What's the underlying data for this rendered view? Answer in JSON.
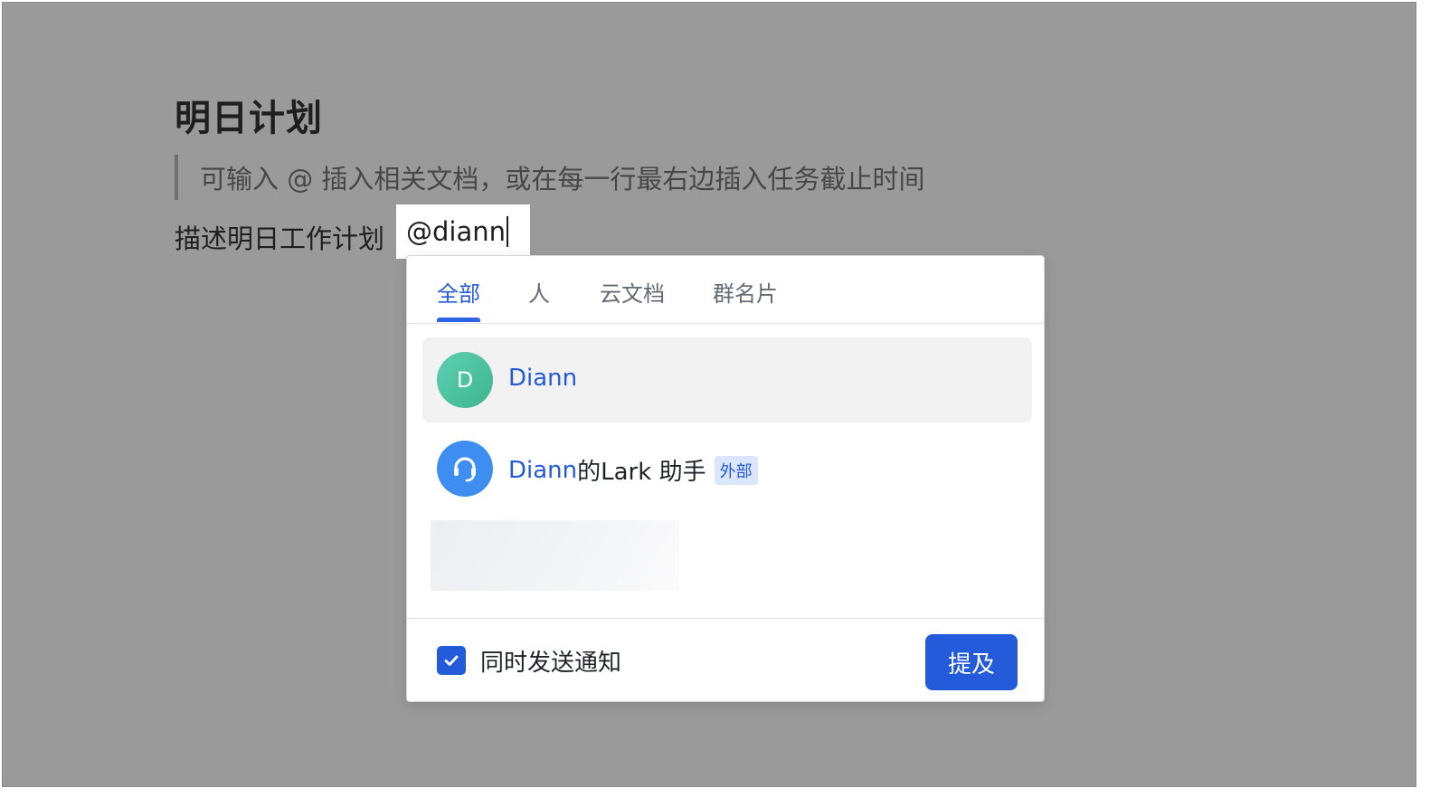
{
  "document": {
    "title": "明日计划",
    "quote_hint": "可输入 @ 插入相关文档，或在每一行最右边插入任务截止时间",
    "body_text": "描述明日工作计划",
    "mention_query": "@diann"
  },
  "mention_popup": {
    "tabs": [
      {
        "label": "全部",
        "active": true
      },
      {
        "label": "人",
        "active": false
      },
      {
        "label": "云文档",
        "active": false
      },
      {
        "label": "群名片",
        "active": false
      }
    ],
    "results": [
      {
        "avatar_text": "D",
        "name_highlight": "Diann",
        "name_rest": "",
        "selected": true
      },
      {
        "avatar_icon": "headset-icon",
        "name_highlight": "Diann",
        "name_rest": "的Lark 助手",
        "badge": "外部",
        "selected": false
      }
    ],
    "footer": {
      "notify_label": "同时发送通知",
      "notify_checked": true,
      "confirm_label": "提及"
    }
  },
  "colors": {
    "accent": "#245bdb",
    "overlay": "#9a9a9a",
    "avatar_teal": "#4fc3a1",
    "avatar_blue": "#3d8ef0",
    "badge_bg": "#dbe5fb"
  }
}
